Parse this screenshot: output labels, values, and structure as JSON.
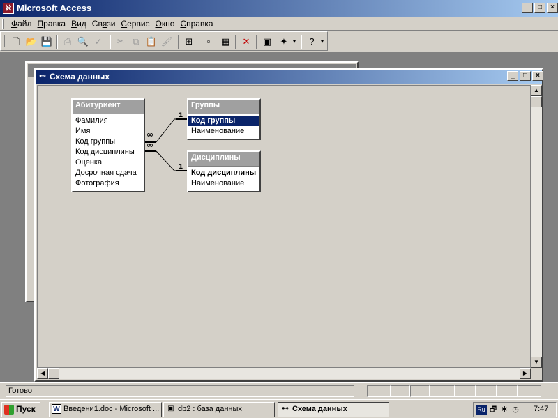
{
  "app": {
    "title": "Microsoft Access"
  },
  "menu": {
    "items": [
      "Файл",
      "Правка",
      "Вид",
      "Связи",
      "Сервис",
      "Окно",
      "Справка"
    ],
    "underline": [
      "Ф",
      "П",
      "В",
      "я",
      "С",
      "О",
      "С"
    ]
  },
  "toolbar": {
    "icons": [
      "new-icon",
      "open-icon",
      "save-icon",
      "print-icon",
      "print-preview-icon",
      "spell-check-icon",
      "cut-icon",
      "copy-icon",
      "paste-icon",
      "format-painter-icon",
      "show-table-icon",
      "direct-relationships-icon",
      "all-relationships-icon",
      "delete-icon",
      "database-window-icon",
      "new-object-icon",
      "help-icon"
    ]
  },
  "schema_window": {
    "title": "Схема данных"
  },
  "tables": [
    {
      "name": "Абитуриент",
      "fields": [
        "Фамилия",
        "Имя",
        "Код группы",
        "Код дисциплины",
        "Оценка",
        "Досрочная сдача",
        "Фотография"
      ]
    },
    {
      "name": "Группы",
      "fields": [
        "Код группы",
        "Наименование"
      ],
      "key_field": "Код группы",
      "selected_field": "Код группы"
    },
    {
      "name": "Дисциплины",
      "fields": [
        "Код дисциплины",
        "Наименование"
      ],
      "key_field": "Код дисциплины"
    }
  ],
  "relationships": {
    "one_label": "1",
    "many_label": "∞"
  },
  "status": {
    "text": "Готово"
  },
  "taskbar": {
    "start_label": "Пуск",
    "tasks": [
      "Введени1.doc - Microsoft ...",
      "db2 : база данных",
      "Схема данных"
    ],
    "lang": "Ru",
    "clock": "7:47"
  }
}
